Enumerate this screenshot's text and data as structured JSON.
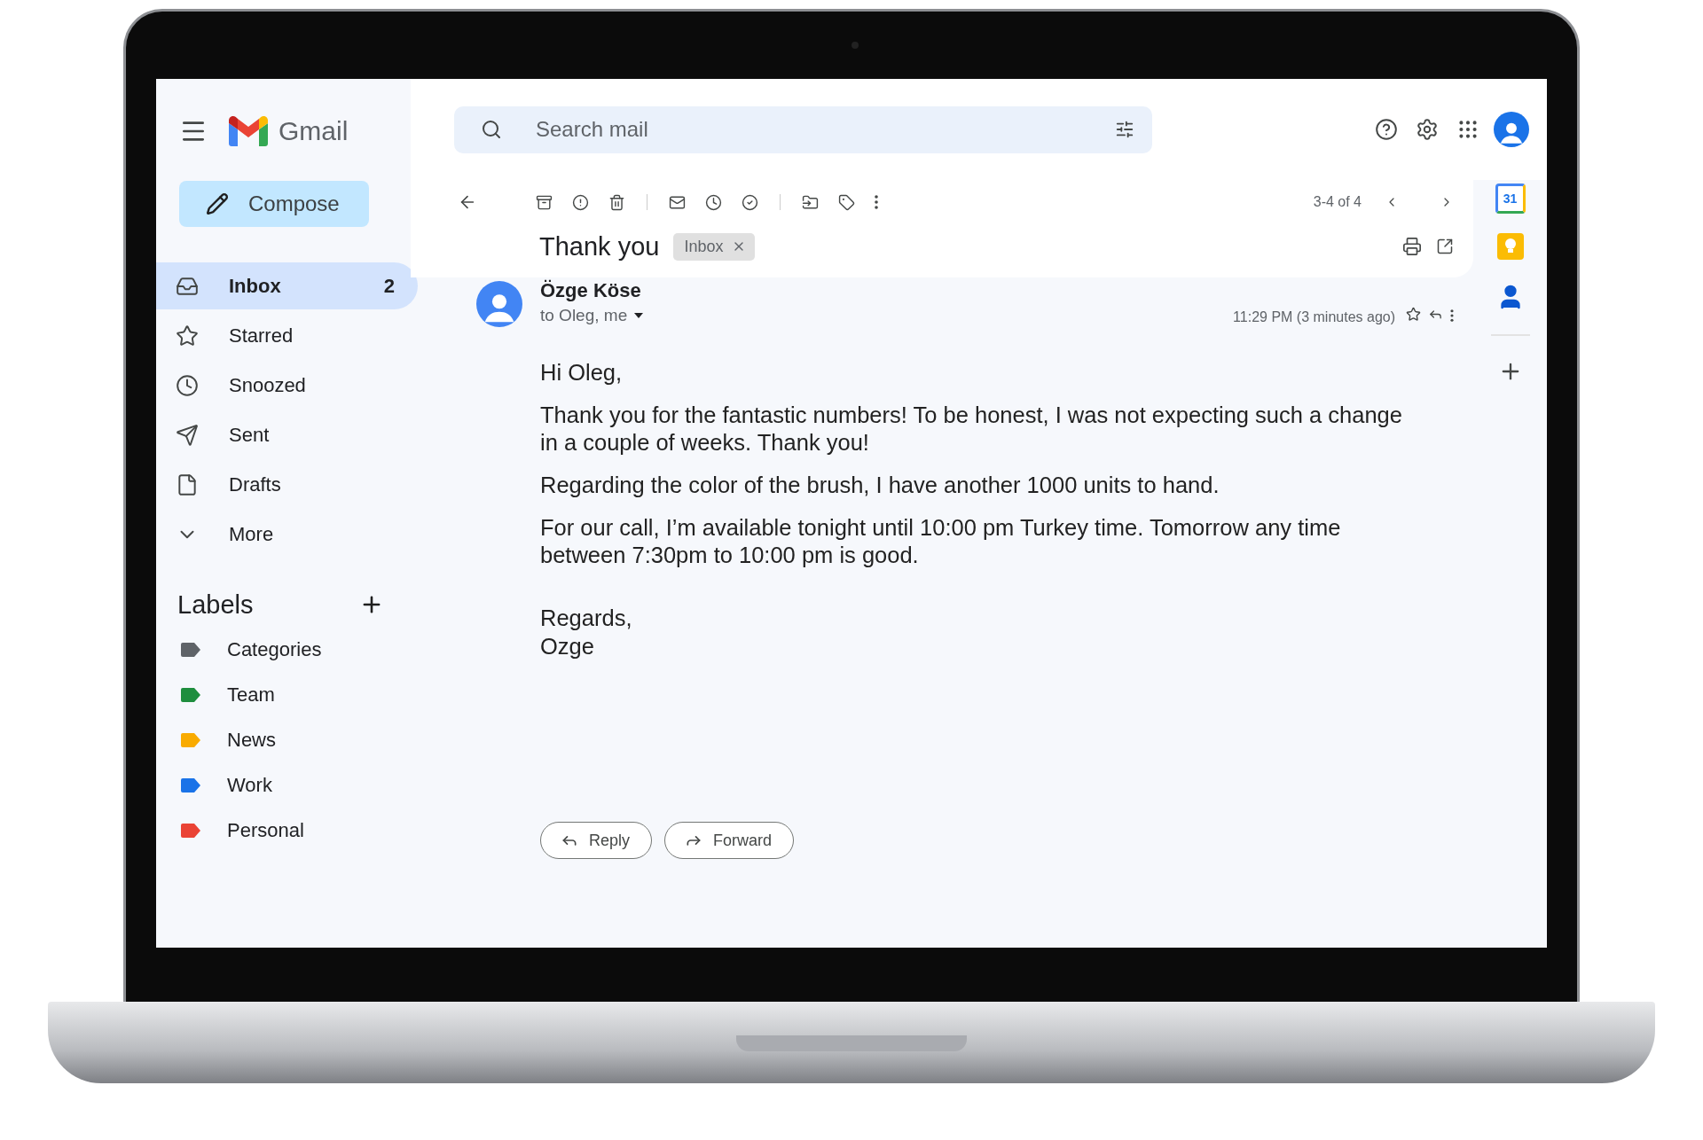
{
  "app": {
    "name": "Gmail"
  },
  "compose": {
    "label": "Compose"
  },
  "nav": [
    {
      "kind": "inbox",
      "label": "Inbox",
      "count": "2",
      "selected": true
    },
    {
      "kind": "starred",
      "label": "Starred",
      "selected": false
    },
    {
      "kind": "snoozed",
      "label": "Snoozed",
      "selected": false
    },
    {
      "kind": "sent",
      "label": "Sent",
      "selected": false
    },
    {
      "kind": "drafts",
      "label": "Drafts",
      "selected": false
    },
    {
      "kind": "more",
      "label": "More",
      "selected": false
    }
  ],
  "labels": {
    "title": "Labels",
    "items": [
      {
        "label": "Categories",
        "color": "#5f6368"
      },
      {
        "label": "Team",
        "color": "#1e8e3e"
      },
      {
        "label": "News",
        "color": "#f9ab00"
      },
      {
        "label": "Work",
        "color": "#1a73e8"
      },
      {
        "label": "Personal",
        "color": "#ea4335"
      }
    ]
  },
  "search": {
    "placeholder": "Search mail"
  },
  "pagination": "3-4 of 4",
  "subject": "Thank you",
  "subject_tags": [
    {
      "label": "Inbox"
    }
  ],
  "message": {
    "sender": "Özge Köse",
    "recipients": "to Oleg, me",
    "time": "11:29 PM (3 minutes ago)",
    "starred": false,
    "paragraphs": [
      "Hi Oleg,",
      "Thank you for the fantastic numbers! To be honest, I was not expecting such a change in a couple of weeks. Thank you!",
      "Regarding the color of the brush, I have another 1000 units to hand.",
      "For our call, I’m available tonight until 10:00 pm Turkey time. Tomorrow any time between 7:30pm to 10:00 pm is good."
    ],
    "closing": [
      "Regards,",
      "Ozge"
    ]
  },
  "actions": [
    {
      "kind": "reply",
      "label": "Reply"
    },
    {
      "kind": "forward",
      "label": "Forward"
    }
  ],
  "side_panel": {
    "calendar_day": "31"
  }
}
